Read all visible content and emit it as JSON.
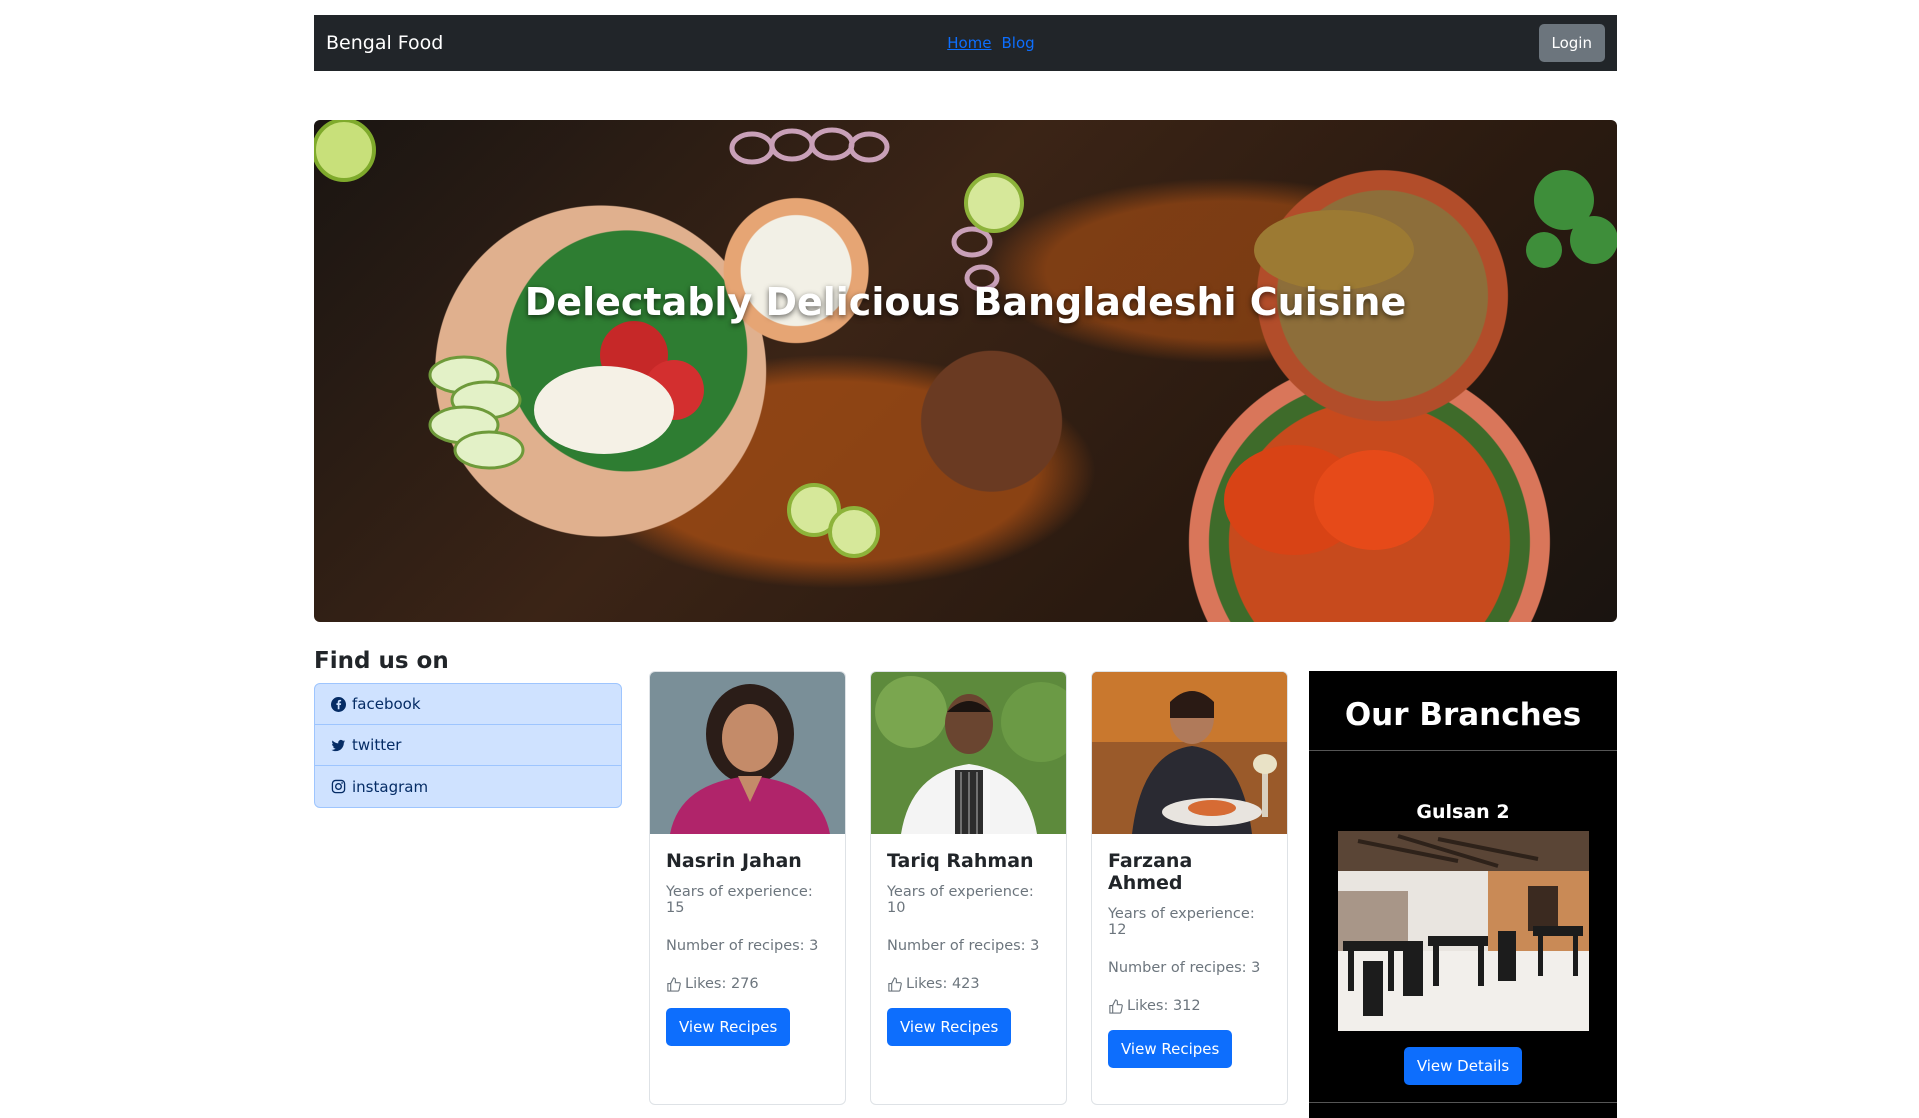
{
  "navbar": {
    "brand": "Bengal Food",
    "links": [
      {
        "label": "Home",
        "active": true
      },
      {
        "label": "Blog",
        "active": false
      }
    ],
    "login_label": "Login"
  },
  "hero": {
    "title": "Delectably Delicious Bangladeshi Cuisine"
  },
  "find_us": {
    "title": "Find us on",
    "items": [
      {
        "label": "facebook",
        "icon": "facebook-icon"
      },
      {
        "label": "twitter",
        "icon": "twitter-icon"
      },
      {
        "label": "instagram",
        "icon": "instagram-icon"
      }
    ]
  },
  "chefs": [
    {
      "name": "Nasrin Jahan",
      "experience": "Years of experience: 15",
      "recipes": "Number of recipes: 3",
      "likes": "Likes: 276",
      "button": "View Recipes"
    },
    {
      "name": "Tariq Rahman",
      "experience": "Years of experience: 10",
      "recipes": "Number of recipes: 3",
      "likes": "Likes: 423",
      "button": "View Recipes"
    },
    {
      "name": "Farzana Ahmed",
      "experience": "Years of experience: 12",
      "recipes": "Number of recipes: 3",
      "likes": "Likes: 312",
      "button": "View Recipes"
    }
  ],
  "branches": {
    "title": "Our Branches",
    "current": {
      "name": "Gulsan 2",
      "button": "View Details"
    }
  },
  "colors": {
    "navbar_bg": "#212529",
    "primary": "#0d6efd",
    "secondary": "#6c757d",
    "social_bg": "#cfe2ff",
    "branches_bg": "#000000"
  }
}
